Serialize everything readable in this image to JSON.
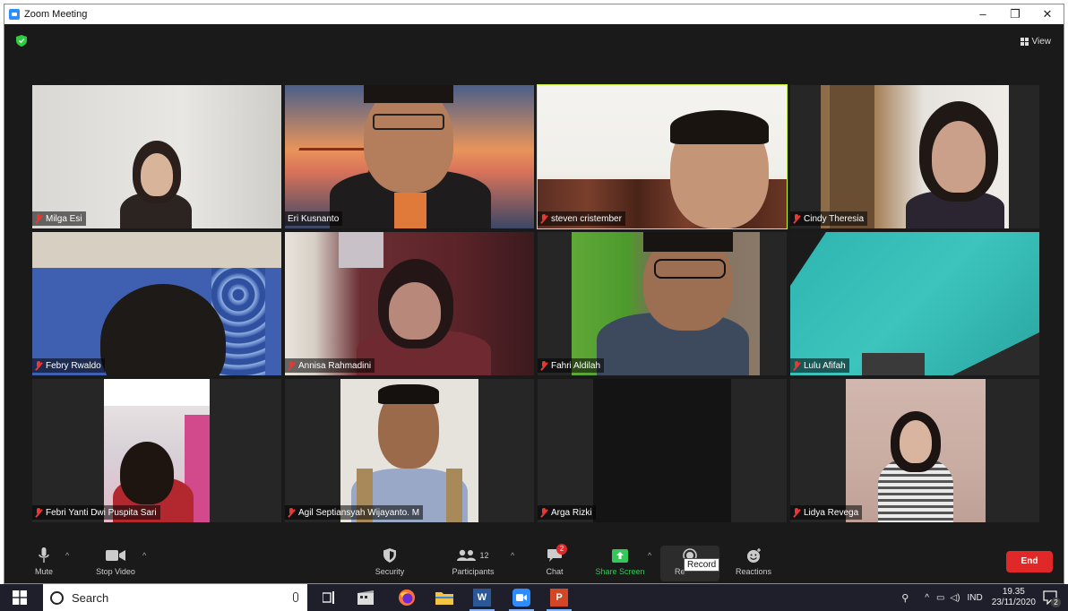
{
  "window": {
    "title": "Zoom Meeting",
    "controls": [
      "–",
      "❐",
      "✕"
    ]
  },
  "meeting": {
    "view_label": "View",
    "participants": [
      {
        "name": "Milga Esi",
        "muted": true
      },
      {
        "name": "Eri Kusnanto",
        "muted": false
      },
      {
        "name": "steven cristember",
        "muted": true,
        "active_speaker": true
      },
      {
        "name": "Cindy Theresia",
        "muted": true
      },
      {
        "name": "Febry Rwaldo",
        "muted": true
      },
      {
        "name": "Annisa Rahmadini",
        "muted": true
      },
      {
        "name": "Fahri Aldilah",
        "muted": true
      },
      {
        "name": "Lulu Afifah",
        "muted": true
      },
      {
        "name": "Febri Yanti Dwi Puspita Sari",
        "muted": true
      },
      {
        "name": "Agil Septiansyah Wijayanto. M",
        "muted": true
      },
      {
        "name": "Arga Rizki",
        "muted": true
      },
      {
        "name": "Lidya Revega",
        "muted": true
      }
    ]
  },
  "toolbar": {
    "mute": "Mute",
    "stop_video": "Stop Video",
    "security": "Security",
    "participants": "Participants",
    "participants_count": "12",
    "chat": "Chat",
    "chat_badge": "2",
    "share_screen": "Share Screen",
    "record_partial": "Re",
    "record_tooltip": "Record",
    "reactions": "Reactions",
    "end": "End",
    "share_color": "#35c759",
    "end_color": "#e02828"
  },
  "taskbar": {
    "search_placeholder": "Search",
    "language": "IND",
    "time": "19.35",
    "date": "23/11/2020",
    "notification_count": "2",
    "apps": [
      "task-view",
      "film-app",
      "firefox",
      "file-explorer",
      "word",
      "zoom",
      "powerpoint"
    ]
  }
}
